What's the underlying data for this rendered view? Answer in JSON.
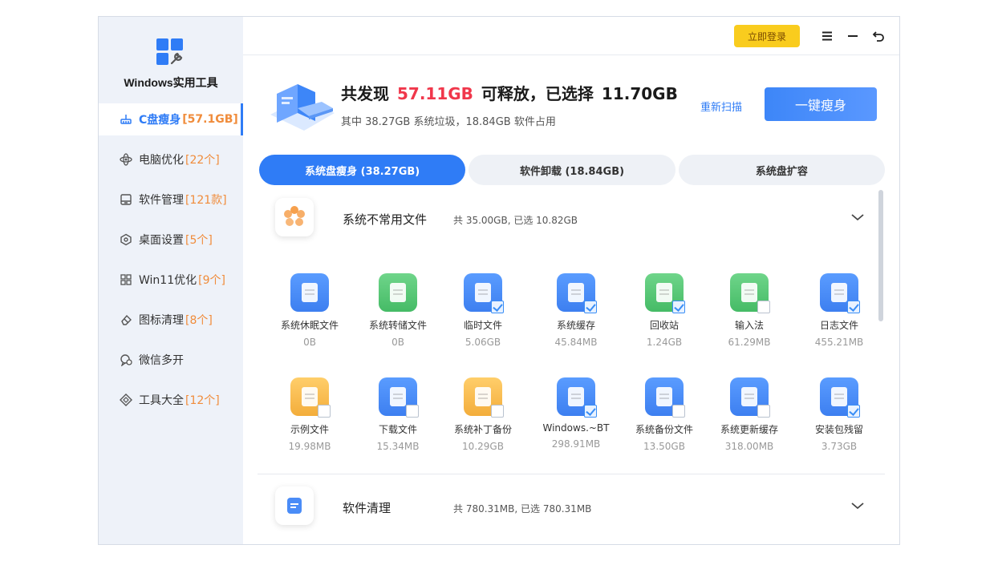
{
  "app": {
    "title": "Windows实用工具"
  },
  "sidebar": {
    "items": [
      {
        "label": "C盘瘦身",
        "count": "[57.1GB]",
        "icon": "broom-icon",
        "active": true
      },
      {
        "label": "电脑优化",
        "count": "[22个]",
        "icon": "atom-icon"
      },
      {
        "label": "软件管理",
        "count": "[121款]",
        "icon": "app-window-icon"
      },
      {
        "label": "桌面设置",
        "count": "[5个]",
        "icon": "hexagon-settings-icon"
      },
      {
        "label": "Win11优化",
        "count": "[9个]",
        "icon": "grid-icon"
      },
      {
        "label": "图标清理",
        "count": "[8个]",
        "icon": "eraser-icon"
      },
      {
        "label": "微信多开",
        "count": "",
        "icon": "chat-icon"
      },
      {
        "label": "工具大全",
        "count": "[12个]",
        "icon": "toolbox-icon"
      }
    ]
  },
  "topbar": {
    "login_label": "立即登录"
  },
  "summary": {
    "found_prefix": "共发现",
    "found_value": "57.11GB",
    "selected_prefix": "可释放，已选择",
    "selected_value": "11.70GB",
    "detail": "其中 38.27GB 系统垃圾，18.84GB 软件占用",
    "rescan_label": "重新扫描",
    "slim_label": "一键瘦身"
  },
  "tabs": [
    {
      "label": "系统盘瘦身 (38.27GB)",
      "active": true
    },
    {
      "label": "软件卸载 (18.84GB)",
      "active": false
    },
    {
      "label": "系统盘扩容",
      "active": false
    }
  ],
  "sections": [
    {
      "title": "系统不常用文件",
      "stat": "共 35.00GB, 已选 10.82GB",
      "icon": "gear-flower-icon",
      "items": [
        {
          "name": "系统休眠文件",
          "size": "0B",
          "color": "blue",
          "checked": false,
          "has_check": false
        },
        {
          "name": "系统转储文件",
          "size": "0B",
          "color": "green",
          "checked": false,
          "has_check": false
        },
        {
          "name": "临时文件",
          "size": "5.06GB",
          "color": "blue",
          "checked": true,
          "has_check": true
        },
        {
          "name": "系统缓存",
          "size": "45.84MB",
          "color": "blue",
          "checked": true,
          "has_check": true
        },
        {
          "name": "回收站",
          "size": "1.24GB",
          "color": "green",
          "checked": true,
          "has_check": true
        },
        {
          "name": "输入法",
          "size": "61.29MB",
          "color": "green",
          "checked": false,
          "has_check": true
        },
        {
          "name": "日志文件",
          "size": "455.21MB",
          "color": "blue",
          "checked": true,
          "has_check": true
        },
        {
          "name": "示例文件",
          "size": "19.98MB",
          "color": "orange",
          "checked": false,
          "has_check": true
        },
        {
          "name": "下载文件",
          "size": "15.34MB",
          "color": "blue",
          "checked": false,
          "has_check": true
        },
        {
          "name": "系统补丁备份",
          "size": "10.29GB",
          "color": "orange",
          "checked": false,
          "has_check": true
        },
        {
          "name": "Windows.~BT",
          "size": "298.91MB",
          "color": "blue",
          "checked": true,
          "has_check": true
        },
        {
          "name": "系统备份文件",
          "size": "13.50GB",
          "color": "blue",
          "checked": false,
          "has_check": true
        },
        {
          "name": "系统更新缓存",
          "size": "318.00MB",
          "color": "blue",
          "checked": false,
          "has_check": true
        },
        {
          "name": "安装包残留",
          "size": "3.73GB",
          "color": "blue",
          "checked": true,
          "has_check": true
        }
      ]
    },
    {
      "title": "软件清理",
      "stat": "共 780.31MB, 已选 780.31MB",
      "icon": "app-box-icon"
    }
  ],
  "colors": {
    "accent": "#2f7cf6",
    "highlight_red": "#f0374b",
    "count_orange": "#f08c3b",
    "login_yellow": "#f9cc1e"
  }
}
